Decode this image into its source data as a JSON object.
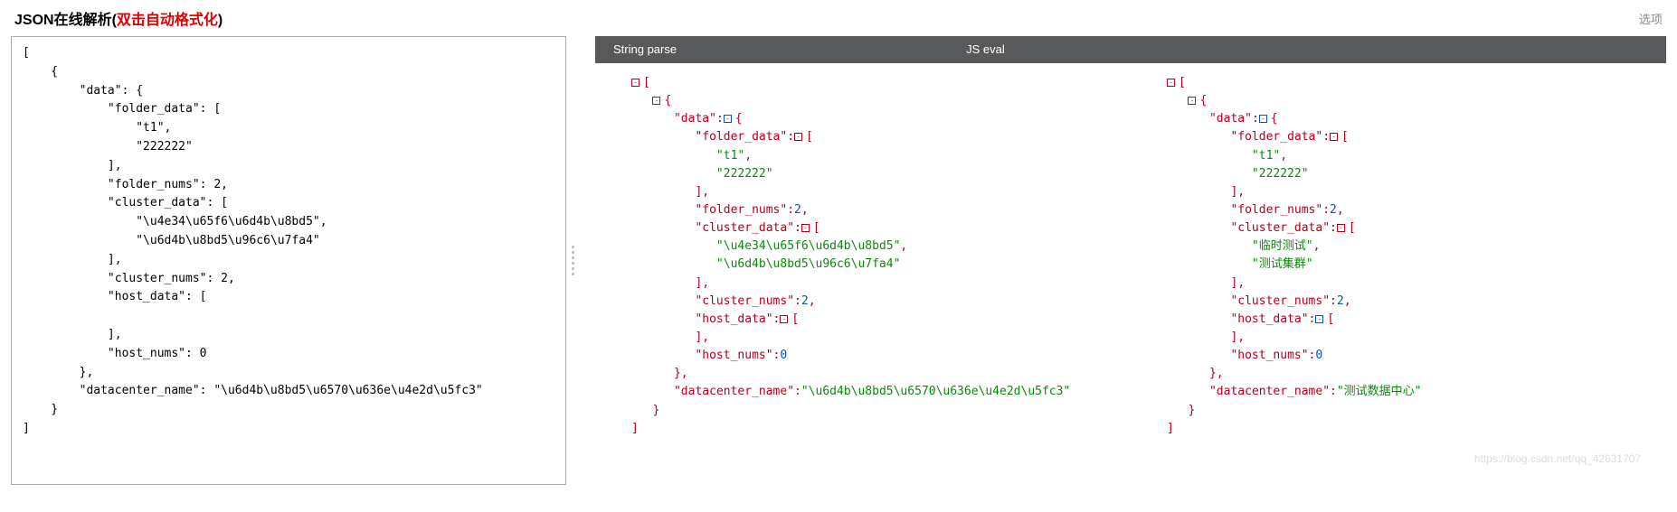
{
  "header": {
    "title_black": "JSON在线解析(",
    "title_red": "双击自动格式化",
    "title_close": ")",
    "options": "选项"
  },
  "tabs": {
    "left": "String parse",
    "right": "JS eval"
  },
  "input_json": "[\n    {\n        \"data\": {\n            \"folder_data\": [\n                \"t1\",\n                \"222222\"\n            ],\n            \"folder_nums\": 2,\n            \"cluster_data\": [\n                \"\\u4e34\\u65f6\\u6d4b\\u8bd5\",\n                \"\\u6d4b\\u8bd5\\u96c6\\u7fa4\"\n            ],\n            \"cluster_nums\": 2,\n            \"host_data\": [\n\n            ],\n            \"host_nums\": 0\n        },\n        \"datacenter_name\": \"\\u6d4b\\u8bd5\\u6570\\u636e\\u4e2d\\u5fc3\"\n    }\n]",
  "parsed": {
    "keys": {
      "data": "\"data\"",
      "folder_data": "\"folder_data\"",
      "folder_nums": "\"folder_nums\"",
      "cluster_data": "\"cluster_data\"",
      "cluster_nums": "\"cluster_nums\"",
      "host_data": "\"host_data\"",
      "host_nums": "\"host_nums\"",
      "datacenter_name": "\"datacenter_name\""
    },
    "string_parse": {
      "folder_data": [
        "\"t1\"",
        "\"222222\""
      ],
      "cluster_data": [
        "\"\\u4e34\\u65f6\\u6d4b\\u8bd5\"",
        "\"\\u6d4b\\u8bd5\\u96c6\\u7fa4\""
      ],
      "datacenter_name": "\"\\u6d4b\\u8bd5\\u6570\\u636e\\u4e2d\\u5fc3\""
    },
    "js_eval": {
      "folder_data": [
        "\"t1\"",
        "\"222222\""
      ],
      "cluster_data": [
        "\"临时测试\"",
        "\"测试集群\""
      ],
      "datacenter_name": "\"测试数据中心\""
    },
    "nums": {
      "folder_nums": "2",
      "cluster_nums": "2",
      "host_nums": "0"
    }
  },
  "watermark": "https://blog.csdn.net/qq_42631707"
}
